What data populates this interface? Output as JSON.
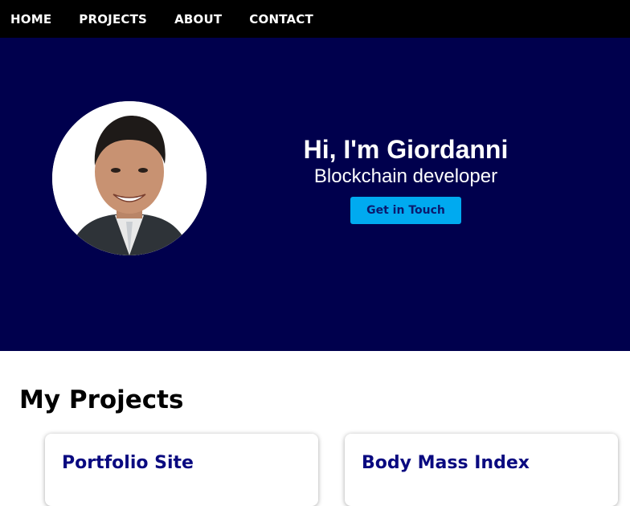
{
  "nav": {
    "items": [
      {
        "label": "HOME"
      },
      {
        "label": "PROJECTS"
      },
      {
        "label": "ABOUT"
      },
      {
        "label": "CONTACT"
      }
    ]
  },
  "hero": {
    "title": "Hi, I'm Giordanni",
    "subtitle": "Blockchain developer",
    "cta_label": "Get in Touch",
    "avatar_alt": "avatar"
  },
  "projects": {
    "heading": "My Projects",
    "cards": [
      {
        "title": "Portfolio Site"
      },
      {
        "title": "Body Mass Index"
      }
    ]
  },
  "colors": {
    "nav_bg": "#000000",
    "hero_bg": "#00004d",
    "cta_bg": "#00aaf0",
    "card_title": "#0a0a80"
  }
}
